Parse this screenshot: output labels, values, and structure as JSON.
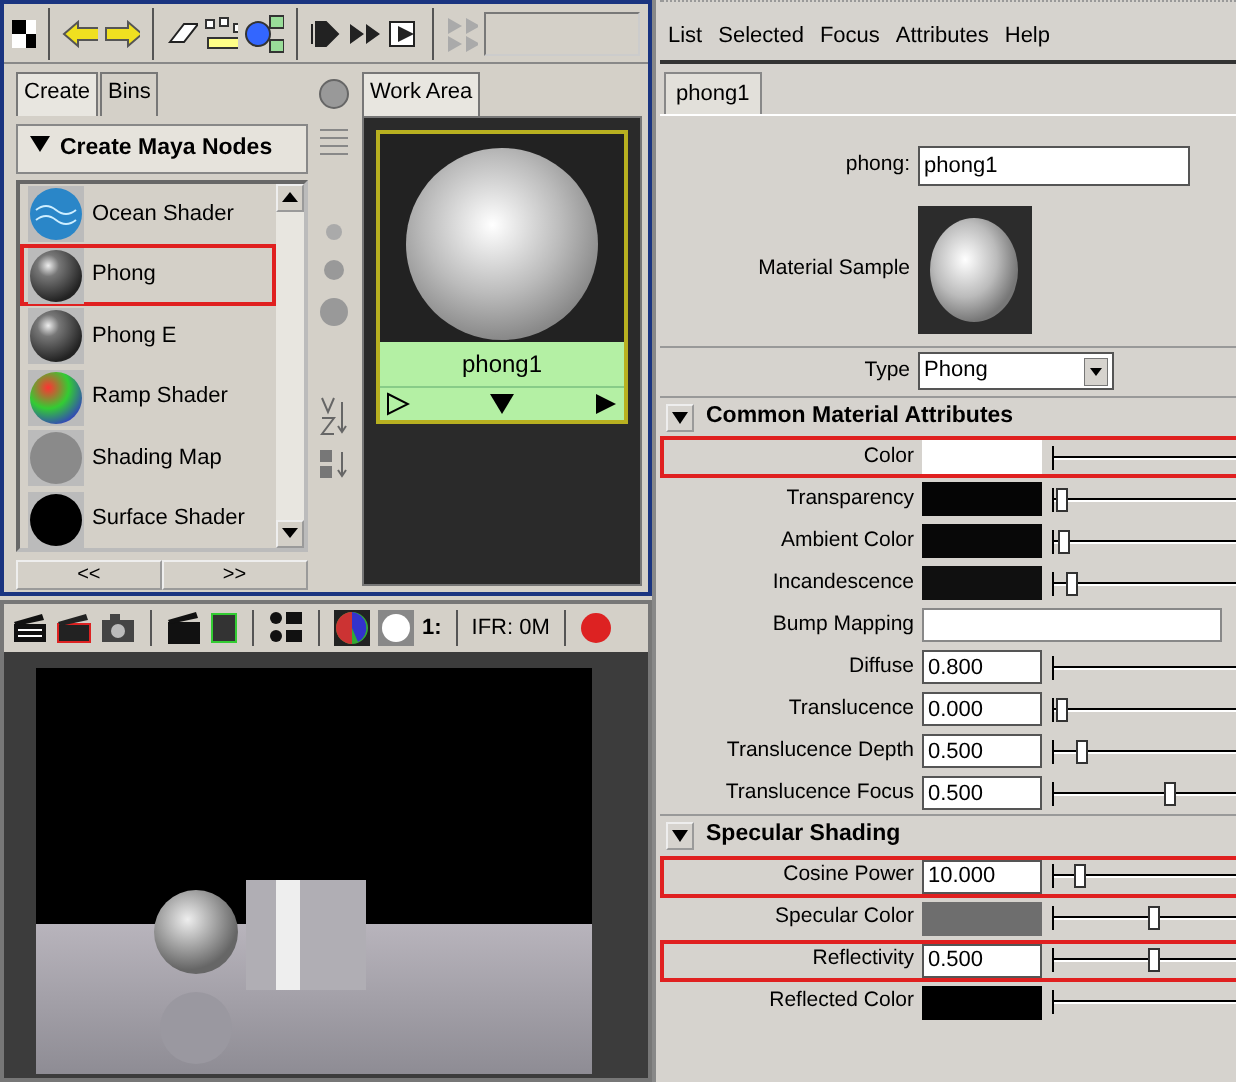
{
  "hypershade": {
    "tabs": [
      {
        "label": "Create",
        "selected": true
      },
      {
        "label": "Bins",
        "selected": false
      }
    ],
    "section": {
      "title": "Create Maya Nodes",
      "expanded": true
    },
    "nodes": [
      {
        "label": "Ocean Shader",
        "kind": "ocean",
        "highlighted": false
      },
      {
        "label": "Phong",
        "kind": "glossy",
        "highlighted": true
      },
      {
        "label": "Phong E",
        "kind": "glossy",
        "highlighted": false
      },
      {
        "label": "Ramp Shader",
        "kind": "ramp",
        "highlighted": false
      },
      {
        "label": "Shading Map",
        "kind": "flat",
        "highlighted": false
      },
      {
        "label": "Surface Shader",
        "kind": "black",
        "highlighted": false
      }
    ],
    "nav": [
      "<<",
      ">>"
    ],
    "work_tabs": [
      {
        "label": "Work Area",
        "selected": true
      }
    ],
    "node_card": {
      "label": "phong1"
    }
  },
  "render_view": {
    "ratio": "1:",
    "frame_info": "IFR: 0M"
  },
  "attribute_editor": {
    "menu": [
      "List",
      "Selected",
      "Focus",
      "Attributes",
      "Help"
    ],
    "tabs": [
      {
        "label": "phong1",
        "selected": true
      }
    ],
    "name_label": "phong:",
    "name_value": "phong1",
    "sample_label": "Material Sample",
    "type_label": "Type",
    "type_value": "Phong",
    "sections": [
      {
        "title": "Common Material Attributes",
        "expanded": true,
        "rows": [
          {
            "label": "Color",
            "kind": "color",
            "color": "#ffffff",
            "highlighted": true
          },
          {
            "label": "Transparency",
            "kind": "color",
            "color": "#050505",
            "level": 0.02,
            "highlighted": false
          },
          {
            "label": "Ambient Color",
            "kind": "color",
            "color": "#080808",
            "level": 0.03,
            "highlighted": false
          },
          {
            "label": "Incandescence",
            "kind": "color",
            "color": "#101010",
            "level": 0.05,
            "highlighted": false
          },
          {
            "label": "Bump Mapping",
            "kind": "map",
            "highlighted": false
          },
          {
            "label": "Diffuse",
            "kind": "number",
            "value": "0.800",
            "highlighted": false
          },
          {
            "label": "Translucence",
            "kind": "number",
            "value": "0.000",
            "level": 0.02,
            "highlighted": false
          },
          {
            "label": "Translucence Depth",
            "kind": "number",
            "value": "0.500",
            "level": 0.08,
            "highlighted": false
          },
          {
            "label": "Translucence Focus",
            "kind": "number",
            "value": "0.500",
            "level": 0.32,
            "highlighted": false
          }
        ]
      },
      {
        "title": "Specular Shading",
        "expanded": true,
        "rows": [
          {
            "label": "Cosine Power",
            "kind": "number",
            "value": "10.000",
            "level": 0.07,
            "highlighted": true
          },
          {
            "label": "Specular Color",
            "kind": "color",
            "color": "#6e6e6e",
            "level": 0.28,
            "highlighted": false
          },
          {
            "label": "Reflectivity",
            "kind": "number",
            "value": "0.500",
            "level": 0.28,
            "highlighted": true
          },
          {
            "label": "Reflected Color",
            "kind": "color",
            "color": "#000000",
            "highlighted": false
          }
        ]
      }
    ]
  }
}
